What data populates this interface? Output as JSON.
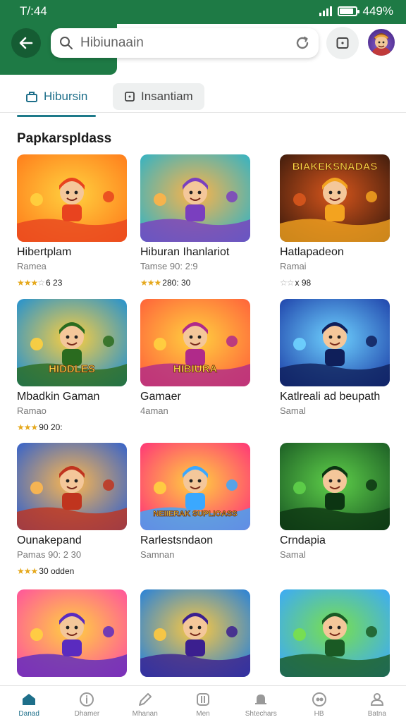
{
  "status_bar": {
    "time": "T/:44",
    "battery": "449%"
  },
  "search": {
    "placeholder": "Hibiunaain"
  },
  "tabs": [
    {
      "label": "Hibursin",
      "icon": "briefcase-icon",
      "active": true
    },
    {
      "label": "Insantiam",
      "icon": "square-icon",
      "active": false
    }
  ],
  "section_title": "Papkarspldass",
  "games": [
    {
      "title": "Hibertplam",
      "subtitle": "Ramea",
      "rating_text": "6 23",
      "stars_on": 3,
      "stars_off": 1
    },
    {
      "title": "Hiburan Ihanlariot",
      "subtitle": "Tamse  90: 2:9",
      "rating_text": "280: 30",
      "stars_on": 3,
      "stars_off": 0
    },
    {
      "title": "Hatlapadeon",
      "subtitle": "Ramai",
      "rating_text": "x 98",
      "stars_on": 0,
      "stars_off": 2
    },
    {
      "title": "Mbadkin Gaman",
      "subtitle": "Ramao",
      "rating_text": "90 20:",
      "stars_on": 3,
      "stars_off": 0
    },
    {
      "title": "Gamaer",
      "subtitle": "4aman",
      "rating_text": "",
      "stars_on": 0,
      "stars_off": 0
    },
    {
      "title": "Katlreali ad beupath",
      "subtitle": "Samal",
      "rating_text": "",
      "stars_on": 0,
      "stars_off": 0
    },
    {
      "title": "Ounakepand",
      "subtitle": "Pamas  90: 2 30",
      "rating_text": "30 odden",
      "stars_on": 3,
      "stars_off": 0
    },
    {
      "title": "Rarlestsndaon",
      "subtitle": "Samnan",
      "rating_text": "",
      "stars_on": 0,
      "stars_off": 0
    },
    {
      "title": "Crndapia",
      "subtitle": "Samal",
      "rating_text": "",
      "stars_on": 0,
      "stars_off": 0
    },
    {
      "title": "",
      "subtitle": "",
      "rating_text": "",
      "stars_on": 0,
      "stars_off": 0
    },
    {
      "title": "",
      "subtitle": "",
      "rating_text": "",
      "stars_on": 0,
      "stars_off": 0
    },
    {
      "title": "",
      "subtitle": "",
      "rating_text": "",
      "stars_on": 0,
      "stars_off": 0
    }
  ],
  "thumb_text": [
    "",
    "",
    "BIAKEKSNADAS",
    "HIDDLES",
    "HIBIURA",
    "",
    "",
    "NEIIERAK SUPLIOASS",
    "",
    "",
    "",
    ""
  ],
  "bottom_nav": [
    {
      "label": "Danad",
      "icon": "home-icon",
      "active": true
    },
    {
      "label": "Dhamer",
      "icon": "info-icon",
      "active": false
    },
    {
      "label": "Mhanan",
      "icon": "pen-icon",
      "active": false
    },
    {
      "label": "Men",
      "icon": "grid-icon",
      "active": false
    },
    {
      "label": "Shtechars",
      "icon": "bell-icon",
      "active": false
    },
    {
      "label": "HB",
      "icon": "eye-icon",
      "active": false
    },
    {
      "label": "Batna",
      "icon": "person-icon",
      "active": false
    }
  ],
  "colors": {
    "brand_green": "#1e7a45",
    "accent_teal": "#1e6f8a",
    "star": "#e5a81c"
  }
}
